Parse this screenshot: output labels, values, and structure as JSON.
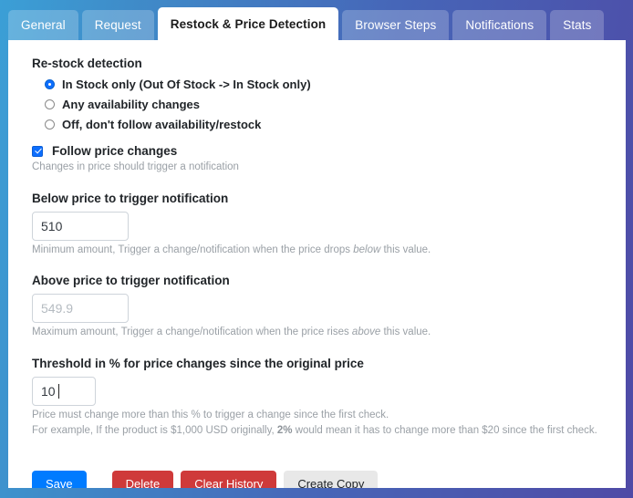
{
  "theme": {
    "gradient_left": "#3b9fd6",
    "gradient_right": "#4f4aa6",
    "accent_blue": "#0d6efd",
    "save_blue": "#007bff",
    "danger_red": "#cf3a3a",
    "light_grey": "#e8e8e8",
    "panel_bg": "#ffffff",
    "page_bg": "#262626"
  },
  "tabs": [
    {
      "label": "General",
      "active": false
    },
    {
      "label": "Request",
      "active": false
    },
    {
      "label": "Restock & Price Detection",
      "active": true
    },
    {
      "label": "Browser Steps",
      "active": false
    },
    {
      "label": "Notifications",
      "active": false
    },
    {
      "label": "Stats",
      "active": false
    }
  ],
  "restock": {
    "title": "Re-stock detection",
    "options": [
      {
        "label": "In Stock only (Out Of Stock -> In Stock only)",
        "checked": true
      },
      {
        "label": "Any availability changes",
        "checked": false
      },
      {
        "label": "Off, don't follow availability/restock",
        "checked": false
      }
    ]
  },
  "follow_price": {
    "label": "Follow price changes",
    "checked": true,
    "helper": "Changes in price should trigger a notification"
  },
  "below_price": {
    "label": "Below price to trigger notification",
    "value": "510",
    "placeholder": "",
    "helper_prefix": "Minimum amount, Trigger a change/notification when the price drops ",
    "helper_em": "below",
    "helper_suffix": " this value."
  },
  "above_price": {
    "label": "Above price to trigger notification",
    "value": "",
    "placeholder": "549.9",
    "helper_prefix": "Maximum amount, Trigger a change/notification when the price rises ",
    "helper_em": "above",
    "helper_suffix": " this value."
  },
  "threshold": {
    "label": "Threshold in % for price changes since the original price",
    "value": "10",
    "placeholder": "",
    "helper_line1": "Price must change more than this % to trigger a change since the first check.",
    "helper_line2_prefix": "For example, If the product is $1,000 USD originally, ",
    "helper_line2_bold": "2%",
    "helper_line2_suffix": " would mean it has to change more than $20 since the first check."
  },
  "buttons": {
    "save": "Save",
    "delete": "Delete",
    "clear_history": "Clear History",
    "create_copy": "Create Copy"
  }
}
